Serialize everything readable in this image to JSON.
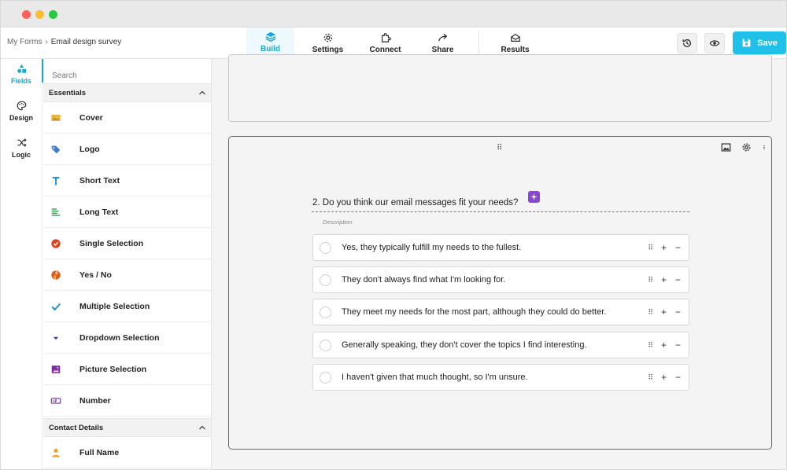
{
  "breadcrumb": {
    "root": "My Forms",
    "separator": "›",
    "current": "Email design survey"
  },
  "nav": [
    {
      "label": "Build",
      "icon": "layers-icon",
      "active": true
    },
    {
      "label": "Settings",
      "icon": "gear-icon"
    },
    {
      "label": "Connect",
      "icon": "puzzle-icon"
    },
    {
      "label": "Share",
      "icon": "share-arrow-icon"
    },
    {
      "label": "Results",
      "icon": "inbox-icon"
    }
  ],
  "actions": {
    "history_icon": "history-icon",
    "preview_icon": "eye-icon",
    "save_label": "Save"
  },
  "rail": [
    {
      "label": "Fields",
      "icon": "shapes-icon",
      "active": true
    },
    {
      "label": "Design",
      "icon": "palette-icon"
    },
    {
      "label": "Logic",
      "icon": "shuffle-icon"
    }
  ],
  "panel": {
    "search_placeholder": "Search",
    "sections": [
      {
        "title": "Essentials",
        "items": [
          {
            "label": "Cover",
            "icon": "cover-image-icon",
            "color": "#e8b53d"
          },
          {
            "label": "Logo",
            "icon": "logo-tag-icon",
            "color": "#3a7bd5"
          },
          {
            "label": "Short Text",
            "icon": "text-t-icon",
            "color": "#1a8fd0"
          },
          {
            "label": "Long Text",
            "icon": "long-text-icon",
            "color": "#2e9e47"
          },
          {
            "label": "Single Selection",
            "icon": "check-circle-icon",
            "color": "#d9451f"
          },
          {
            "label": "Yes / No",
            "icon": "yes-no-icon",
            "color": "#e05a1a"
          },
          {
            "label": "Multiple Selection",
            "icon": "checkmark-icon",
            "color": "#1a8fd0"
          },
          {
            "label": "Dropdown Selection",
            "icon": "dropdown-icon",
            "color": "#3b2fb0"
          },
          {
            "label": "Picture Selection",
            "icon": "picture-icon",
            "color": "#7a2d9c"
          },
          {
            "label": "Number",
            "icon": "number-icon",
            "color": "#7a2d9c"
          }
        ]
      },
      {
        "title": "Contact Details",
        "items": [
          {
            "label": "Full Name",
            "icon": "person-icon",
            "color": "#f0a62a"
          }
        ]
      }
    ]
  },
  "question": {
    "number": "2.",
    "text": "Do you think our email messages fit your needs?",
    "description_placeholder": "Description",
    "options": [
      "Yes, they typically fulfill my needs to the fullest.",
      "They don't always find what I'm looking for.",
      "They meet my needs for the most part, although they could do better.",
      "Generally speaking, they don't cover the topics I find interesting.",
      "I haven't given that much thought, so I'm unsure."
    ]
  },
  "colors": {
    "accent": "#21c0e8",
    "active_nav": "#1aa6cf",
    "ai_badge": "#8a44d6"
  }
}
